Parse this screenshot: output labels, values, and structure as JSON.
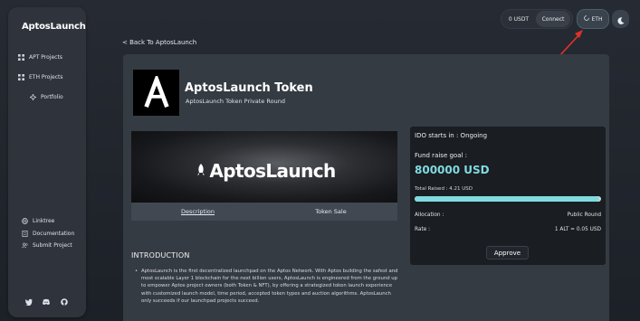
{
  "app": {
    "brand": "AptosLaunch"
  },
  "sidebar": {
    "items": [
      {
        "label": "APT Projects",
        "icon": "grid-icon"
      },
      {
        "label": "ETH Projects",
        "icon": "grid-icon"
      },
      {
        "label": "Portfolio",
        "icon": "sparkle-icon"
      }
    ],
    "links": [
      {
        "label": "Linktree",
        "icon": "globe-icon"
      },
      {
        "label": "Documentation",
        "icon": "document-icon"
      },
      {
        "label": "Submit Project",
        "icon": "users-icon"
      }
    ],
    "social": [
      "twitter-icon",
      "discord-icon",
      "github-icon"
    ]
  },
  "header": {
    "balance": "0 USDT",
    "connect_label": "Connect",
    "chain_label": "ETH",
    "theme_icon": "moon-icon"
  },
  "back_link": "< Back To AptosLaunch",
  "token": {
    "title": "AptosLaunch Token",
    "subtitle": "AptosLaunch Token Private Round"
  },
  "banner_text": "AptosLaunch",
  "tabs": [
    "Description",
    "Token Sale"
  ],
  "intro": {
    "title": "INTRODUCTION",
    "body": "AptosLaunch is the first decentralized launchpad on the Aptos Network. With Aptos building the safest and most scalable Layer 1 blockchain for the next billion users, AptosLaunch is engineered from the ground up to empower Aptos project owners (both Token & NFT), by offering a strategized token launch experience with customized launch model, time period, accepted token types and auction algorithms. AptosLaunch only succeeds if our launchpad projects succeed."
  },
  "ido": {
    "status": "IDO starts in : Ongoing",
    "fund_label": "Fund raise goal :",
    "fund_goal": "800000 USD",
    "total_raised": "Total Raised : 4.21 USD",
    "progress_fraction": 0.99,
    "allocation_label": "Allocation :",
    "allocation_value": "Public Round",
    "rate_label": "Rate :",
    "rate_value": "1 ALT = 0.05 USD",
    "approve_label": "Approve"
  },
  "colors": {
    "accent": "#7fdbe0",
    "annotation_arrow": "#e0312a"
  }
}
